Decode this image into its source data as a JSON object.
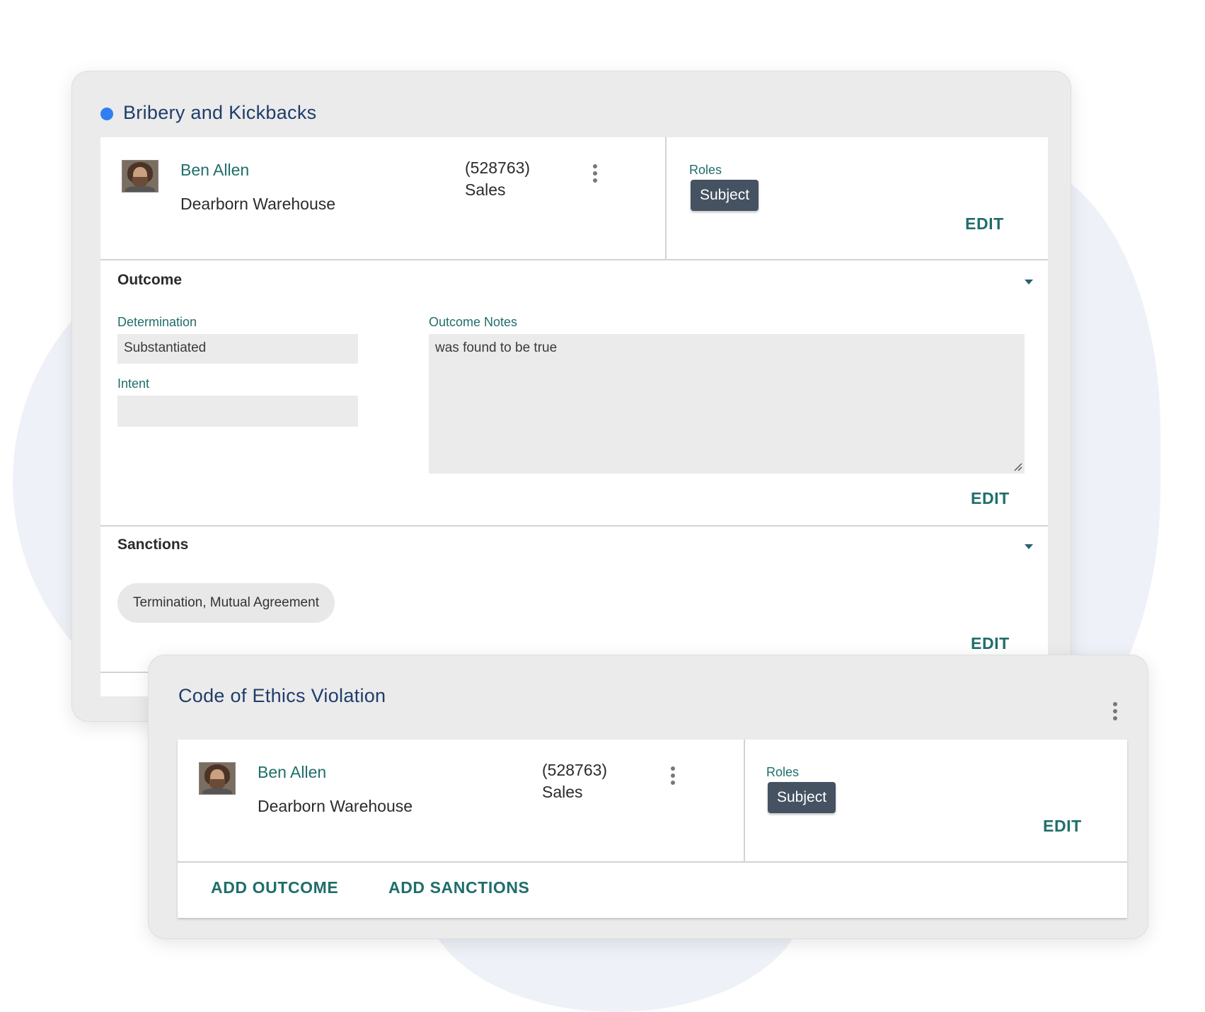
{
  "card1": {
    "title": "Bribery and Kickbacks",
    "person": {
      "name": "Ben Allen",
      "location": "Dearborn Warehouse",
      "id": "(528763)",
      "department": "Sales"
    },
    "roles_label": "Roles",
    "role": "Subject",
    "edit_label": "EDIT",
    "outcome": {
      "title": "Outcome",
      "determination_label": "Determination",
      "determination_value": "Substantiated",
      "intent_label": "Intent",
      "intent_value": "",
      "notes_label": "Outcome Notes",
      "notes_value": "was found to be true",
      "edit_label": "EDIT"
    },
    "sanctions": {
      "title": "Sanctions",
      "items": [
        "Termination, Mutual Agreement"
      ],
      "edit_label": "EDIT"
    }
  },
  "card2": {
    "title": "Code of Ethics Violation",
    "person": {
      "name": "Ben Allen",
      "location": "Dearborn Warehouse",
      "id": "(528763)",
      "department": "Sales"
    },
    "roles_label": "Roles",
    "role": "Subject",
    "edit_label": "EDIT",
    "add_outcome_label": "ADD OUTCOME",
    "add_sanctions_label": "ADD SANCTIONS"
  },
  "colors": {
    "accent_teal": "#1f6e6a",
    "title_navy": "#1f3d6b",
    "status_dot": "#2f7ff0",
    "role_chip": "#455262"
  },
  "icons": [
    "status-dot",
    "avatar",
    "kebab-menu-icon",
    "caret-down-icon",
    "resize-handle-icon"
  ]
}
